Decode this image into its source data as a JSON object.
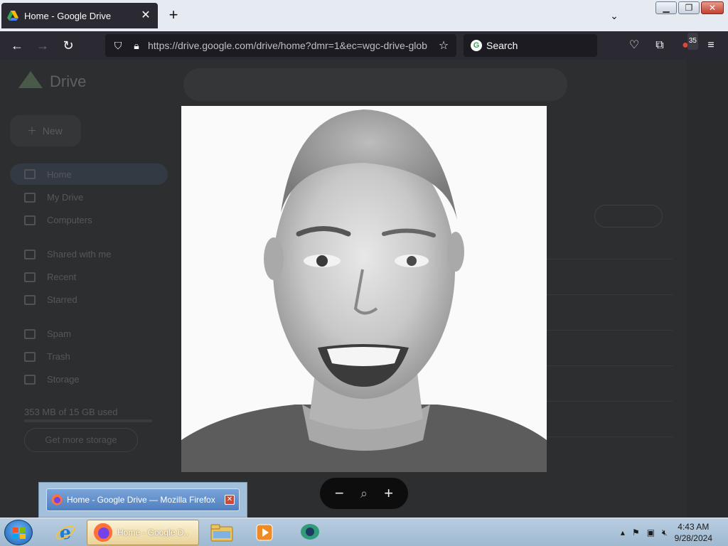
{
  "browser": {
    "tab_title": "Home - Google Drive",
    "new_tab": "+",
    "url": "https://drive.google.com/drive/home?dmr=1&ec=wgc-drive-glob",
    "search_placeholder": "Search",
    "notification_count": "35"
  },
  "drive": {
    "logo_text": "Drive",
    "new_button": "New",
    "nav": [
      {
        "label": "Home"
      },
      {
        "label": "My Drive"
      },
      {
        "label": "Computers"
      },
      {
        "label": "Shared with me"
      },
      {
        "label": "Recent"
      },
      {
        "label": "Starred"
      },
      {
        "label": "Spam"
      },
      {
        "label": "Trash"
      },
      {
        "label": "Storage"
      }
    ],
    "storage_text": "353 MB of 15 GB used",
    "get_storage_button": "Get more storage"
  },
  "viewer": {
    "zoom_out": "−",
    "zoom_reset": "🔍",
    "zoom_in": "+"
  },
  "tooltip": {
    "title": "Home - Google Drive — Mozilla Firefox"
  },
  "taskbar": {
    "active_label": "Home - Google D...",
    "time": "4:43 AM",
    "date": "9/28/2024"
  },
  "colors": {
    "firefox_bar": "#2b2a33",
    "dim_page": "#2d2e30",
    "taskbar": "#b9cde0"
  }
}
